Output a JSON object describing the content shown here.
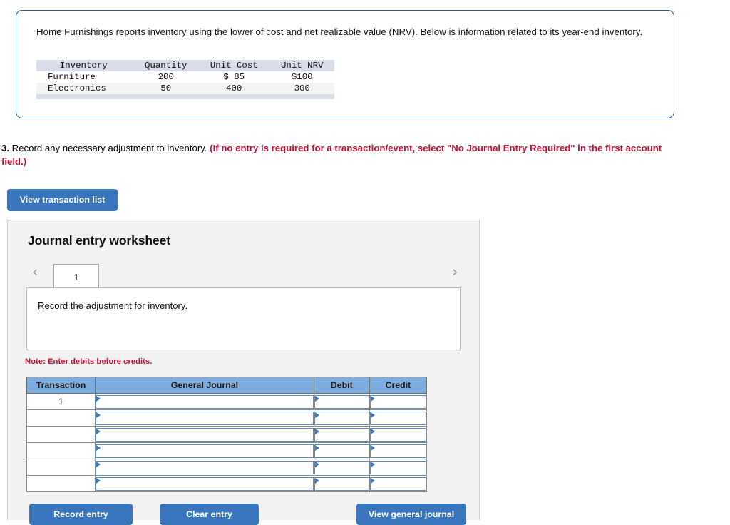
{
  "info_panel": {
    "paragraph": "Home Furnishings reports inventory using the lower of cost and net realizable value (NRV). Below is information related to its year-end inventory.",
    "table": {
      "headers": [
        "Inventory",
        "Quantity",
        "Unit Cost",
        "Unit NRV"
      ],
      "rows": [
        [
          "Furniture",
          "200",
          "$ 85",
          "$100"
        ],
        [
          "Electronics",
          "50",
          "400",
          "300"
        ]
      ]
    }
  },
  "question": {
    "number": "3.",
    "text": " Record any necessary adjustment to inventory. ",
    "red_note": "(If no entry is required for a transaction/event, select \"No Journal Entry Required\" in the first account field.)"
  },
  "toolbar": {
    "view_transaction_list_label": "View transaction list"
  },
  "worksheet": {
    "title": "Journal entry worksheet",
    "prev_icon": "‹",
    "next_icon": "›",
    "tabs": [
      "1"
    ],
    "prompt": "Record the adjustment for inventory.",
    "note": "Note: Enter debits before credits.",
    "table": {
      "headers": [
        "Transaction",
        "General Journal",
        "Debit",
        "Credit"
      ],
      "rows": [
        {
          "transaction": "1",
          "general_journal": "",
          "debit": "",
          "credit": ""
        },
        {
          "transaction": "",
          "general_journal": "",
          "debit": "",
          "credit": ""
        },
        {
          "transaction": "",
          "general_journal": "",
          "debit": "",
          "credit": ""
        },
        {
          "transaction": "",
          "general_journal": "",
          "debit": "",
          "credit": ""
        },
        {
          "transaction": "",
          "general_journal": "",
          "debit": "",
          "credit": ""
        },
        {
          "transaction": "",
          "general_journal": "",
          "debit": "",
          "credit": ""
        }
      ]
    },
    "actions": {
      "record_entry": "Record entry",
      "clear_entry": "Clear entry",
      "view_general_journal": "View general journal"
    }
  },
  "colors": {
    "button_blue": "#3a76bd",
    "table_header_blue": "#7cacdd",
    "panel_border_blue": "#1f5c99",
    "red_text": "#c8102e",
    "panel_bg": "#f2f2f2"
  }
}
